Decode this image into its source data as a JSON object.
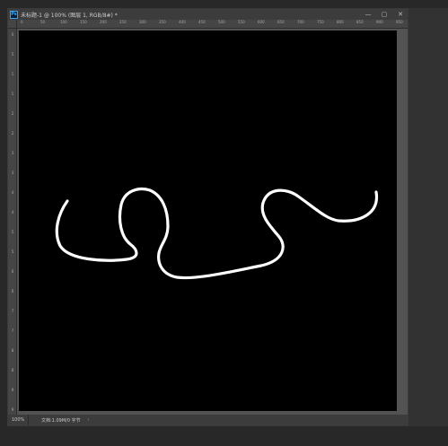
{
  "window": {
    "icon_label": "Ps",
    "title": "未标题-1 @ 100% (图层 1, RGB/8#) *",
    "controls": {
      "minimize": "—",
      "maximize": "▢",
      "close": "✕"
    }
  },
  "ruler": {
    "h_labels": [
      "0",
      "50",
      "100",
      "150",
      "200",
      "250",
      "300",
      "350",
      "400",
      "450",
      "500",
      "550",
      "600",
      "650",
      "700",
      "750",
      "800",
      "850",
      "900",
      "950"
    ],
    "v_labels": [
      "0",
      "5",
      "1",
      "1",
      "2",
      "2",
      "3",
      "3",
      "4",
      "4",
      "5",
      "5",
      "6",
      "6",
      "7",
      "7",
      "8",
      "8",
      "9",
      "9"
    ]
  },
  "canvas": {
    "background": "#000000",
    "stroke_color": "#ffffff"
  },
  "status": {
    "zoom": "100%",
    "doc_info": "文档:1.09M/0 字节",
    "arrow": "›"
  }
}
